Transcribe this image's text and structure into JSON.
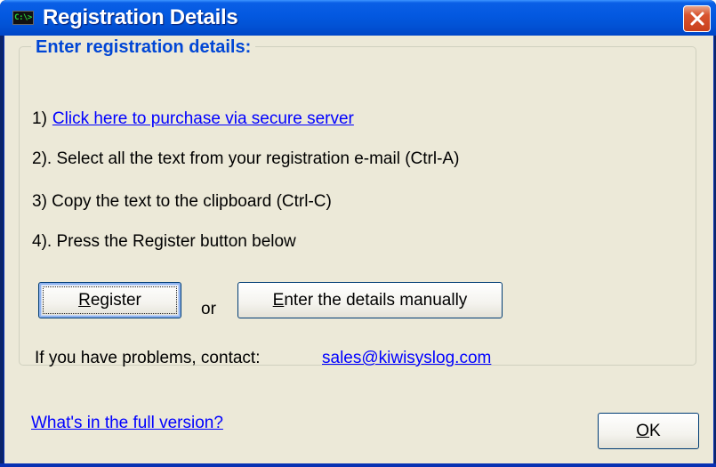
{
  "window": {
    "title": "Registration Details",
    "icon_label": "C:\\>",
    "icon": "console-icon",
    "close_icon": "close-icon"
  },
  "group": {
    "label": "Enter registration details:"
  },
  "steps": [
    {
      "num": "1)",
      "text": "Click here to purchase via secure server",
      "is_link": true
    },
    {
      "num": "",
      "text": "2). Select all the text from your registration e-mail (Ctrl-A)",
      "is_link": false
    },
    {
      "num": "",
      "text": "3)  Copy the text to the clipboard (Ctrl-C)",
      "is_link": false
    },
    {
      "num": "",
      "text": "4). Press the Register button below",
      "is_link": false
    }
  ],
  "buttons": {
    "register": {
      "mnemonic": "R",
      "rest": "egister"
    },
    "or_text": "or",
    "manual": {
      "mnemonic": "E",
      "rest": "nter the details manually"
    },
    "ok": {
      "mnemonic": "O",
      "rest": "K"
    }
  },
  "contact": {
    "label": "If you have problems, contact:",
    "email": "sales@kiwisyslog.com"
  },
  "full_version_link": "What's in the full version?",
  "colors": {
    "titlebar": "#0358e0",
    "group_label": "#0046d5",
    "link": "#0000ff",
    "dialog_bg": "#ece9d8"
  }
}
